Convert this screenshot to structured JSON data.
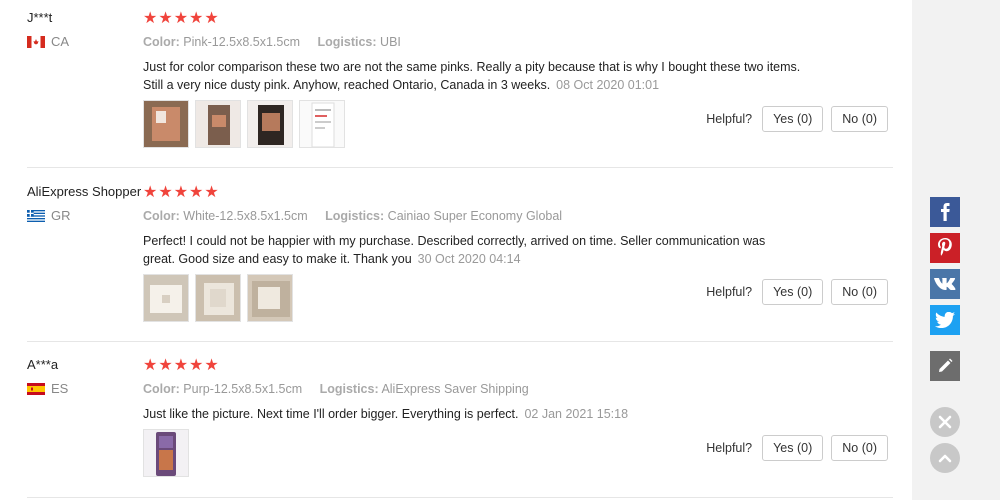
{
  "reviews": [
    {
      "user": "J***t",
      "country": "CA",
      "stars": "★★★★★",
      "color_label": "Color:",
      "color_value": "Pink-12.5x8.5x1.5cm",
      "logistics_label": "Logistics:",
      "logistics_value": "UBI",
      "text": "Just for color comparison these two are not the same pinks. Really a pity because that is why I bought these two items. Still a very nice dusty pink. Anyhow, reached Ontario, Canada in 3 weeks.",
      "date": "08 Oct 2020 01:01",
      "helpful_label": "Helpful?",
      "yes_label": "Yes (0)",
      "no_label": "No (0)"
    },
    {
      "user": "AliExpress Shopper",
      "country": "GR",
      "stars": "★★★★★",
      "color_label": "Color:",
      "color_value": "White-12.5x8.5x1.5cm",
      "logistics_label": "Logistics:",
      "logistics_value": "Cainiao Super Economy Global",
      "text": "Perfect! I could not be happier with my purchase. Described correctly, arrived on time. Seller communication was great. Good size and easy to make it. Thank you",
      "date": "30 Oct 2020 04:14",
      "helpful_label": "Helpful?",
      "yes_label": "Yes (0)",
      "no_label": "No (0)"
    },
    {
      "user": "A***a",
      "country": "ES",
      "stars": "★★★★★",
      "color_label": "Color:",
      "color_value": "Purp-12.5x8.5x1.5cm",
      "logistics_label": "Logistics:",
      "logistics_value": "AliExpress Saver Shipping",
      "text": "Just like the picture. Next time I'll order bigger. Everything is perfect.",
      "date": "02 Jan 2021 15:18",
      "helpful_label": "Helpful?",
      "yes_label": "Yes (0)",
      "no_label": "No (0)"
    }
  ],
  "share_icons": [
    "facebook-icon",
    "pinterest-icon",
    "vk-icon",
    "twitter-icon",
    "edit-icon"
  ],
  "float_icons": [
    "close-icon",
    "chevron-up-icon"
  ],
  "colors": {
    "stars": "#f0443c",
    "facebook": "#3b5998",
    "pinterest": "#cb2027",
    "vk": "#4a76a8",
    "twitter": "#1da1f2",
    "edit": "#6d6d6d"
  }
}
